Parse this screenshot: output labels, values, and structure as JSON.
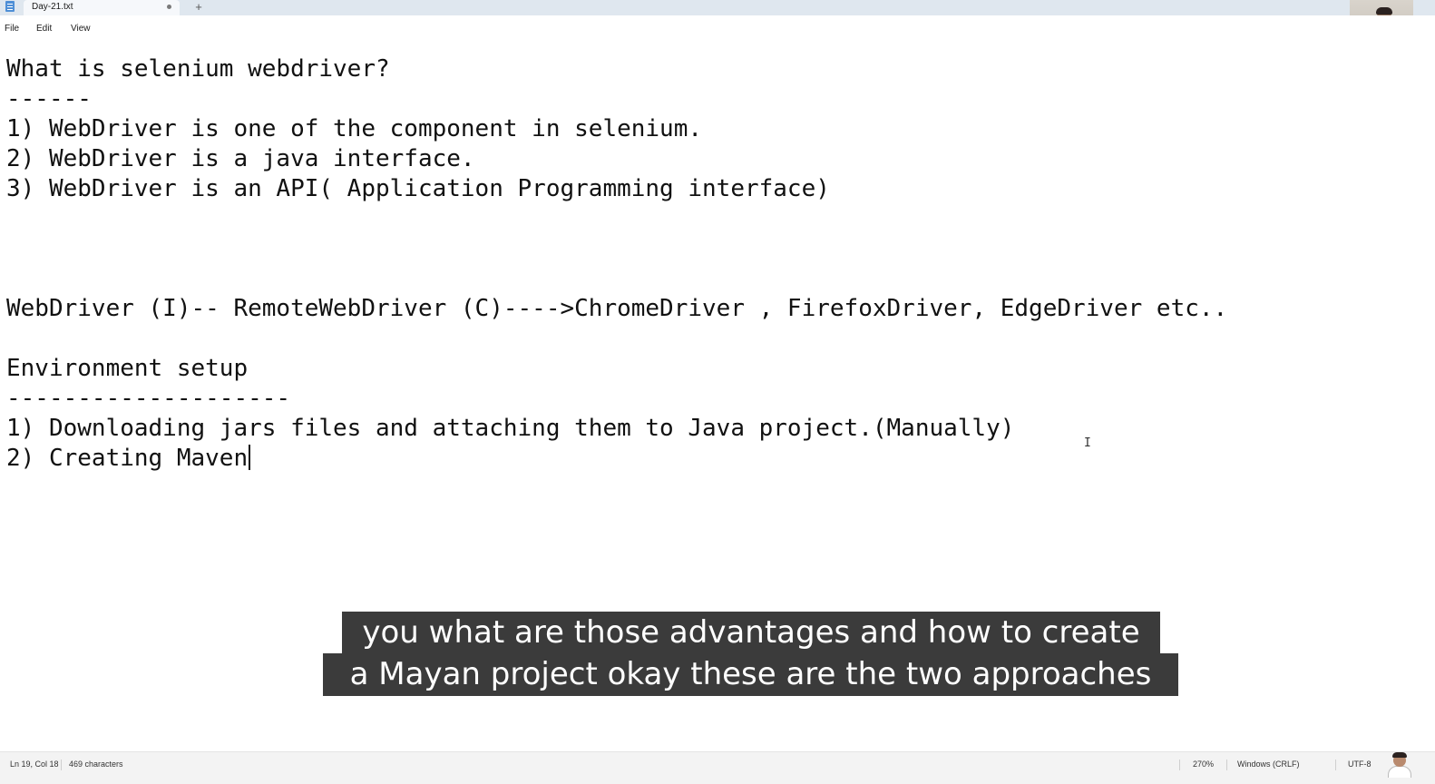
{
  "window": {
    "tab_title": "Day-21.txt",
    "new_tab_symbol": "+"
  },
  "menu": {
    "file": "File",
    "edit": "Edit",
    "view": "View"
  },
  "editor": {
    "lines": [
      "What is selenium webdriver?",
      "------",
      "1) WebDriver is one of the component in selenium.",
      "2) WebDriver is a java interface.",
      "3) WebDriver is an API( Application Programming interface)",
      "",
      "",
      "",
      "WebDriver (I)-- RemoteWebDriver (C)---->ChromeDriver , FirefoxDriver, EdgeDriver etc..",
      "",
      "Environment setup",
      "--------------------",
      "1) Downloading jars files and attaching them to Java project.(Manually)",
      "2) Creating Maven"
    ]
  },
  "captions": {
    "line1": "you what are those advantages and how to create",
    "line2": "a Mayan project okay these are the two approaches"
  },
  "status": {
    "position": "Ln 19, Col 18",
    "characters": "469 characters",
    "zoom": "270%",
    "line_ending": "Windows (CRLF)",
    "encoding": "UTF-8"
  },
  "icons": {
    "app": "notepad-icon",
    "unsaved": "unsaved-dot-icon",
    "cursor": "text-cursor-icon"
  },
  "colors": {
    "titlebar": "#dfe7ef",
    "caption_bg": "#3b3b3b",
    "statusbar": "#f3f3f3"
  }
}
